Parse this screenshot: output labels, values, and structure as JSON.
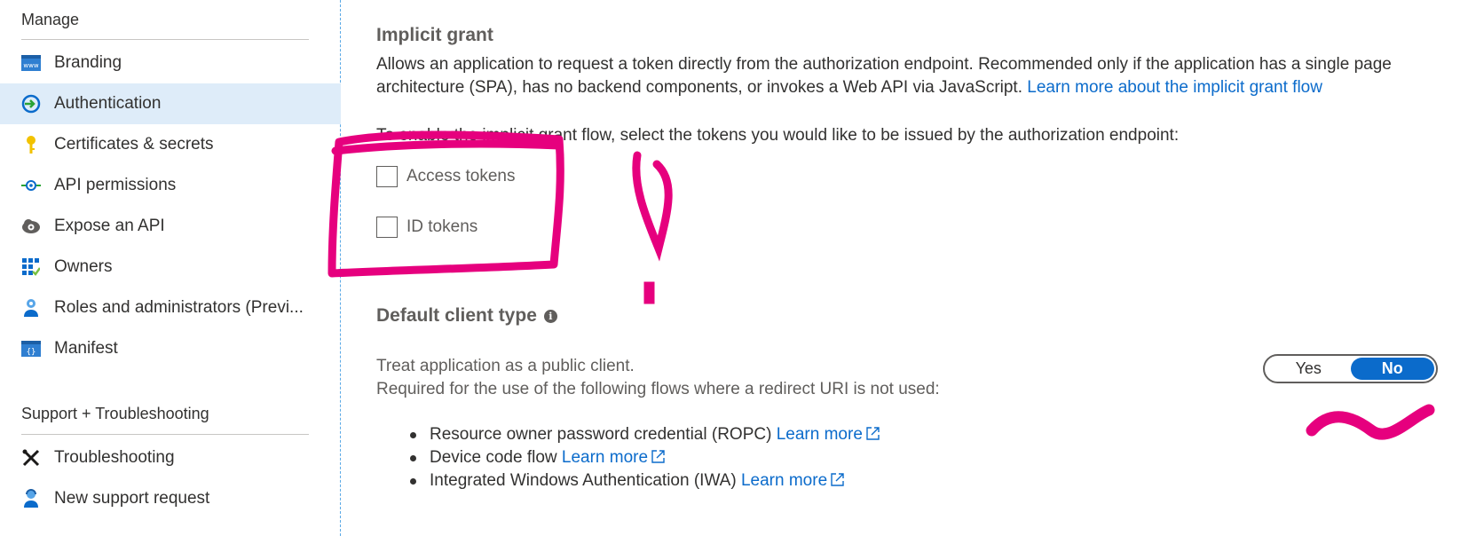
{
  "sidebar": {
    "manage_title": "Manage",
    "items": [
      {
        "label": "Branding",
        "icon": "www-icon"
      },
      {
        "label": "Authentication",
        "icon": "authentication-icon",
        "selected": true
      },
      {
        "label": "Certificates & secrets",
        "icon": "key-icon"
      },
      {
        "label": "API permissions",
        "icon": "api-permissions-icon"
      },
      {
        "label": "Expose an API",
        "icon": "cloud-gear-icon"
      },
      {
        "label": "Owners",
        "icon": "owners-grid-icon"
      },
      {
        "label": "Roles and administrators (Previ...",
        "icon": "user-roles-icon"
      },
      {
        "label": "Manifest",
        "icon": "manifest-icon"
      }
    ],
    "support_title": "Support + Troubleshooting",
    "support_items": [
      {
        "label": "Troubleshooting",
        "icon": "tools-icon"
      },
      {
        "label": "New support request",
        "icon": "support-person-icon"
      }
    ]
  },
  "main": {
    "implicit_title": "Implicit grant",
    "implicit_desc": "Allows an application to request a token directly from the authorization endpoint. Recommended only if the application has a single page",
    "implicit_desc2": "architecture (SPA), has no backend components, or invokes a Web API via JavaScript.",
    "implicit_link": "Learn more about the implicit grant flow",
    "enable_text": "To enable the implicit grant flow, select the tokens you would like to be issued by the authorization endpoint:",
    "checkboxes": [
      {
        "label": "Access tokens",
        "checked": false
      },
      {
        "label": "ID tokens",
        "checked": false
      }
    ],
    "client_type_title": "Default client type",
    "public_client_text": "Treat application as a public client.",
    "required_text": "Required for the use of the following flows where a redirect URI is not used:",
    "flows": [
      {
        "text": "Resource owner password credential (ROPC)",
        "link": "Learn more"
      },
      {
        "text": "Device code flow",
        "link": "Learn more"
      },
      {
        "text": "Integrated Windows Authentication (IWA)",
        "link": "Learn more"
      }
    ],
    "toggle": {
      "yes": "Yes",
      "no": "No",
      "selected": "No"
    }
  },
  "colors": {
    "accent": "#0b6bcb",
    "selected_bg": "#deecf9",
    "annotation": "#e6007e"
  }
}
